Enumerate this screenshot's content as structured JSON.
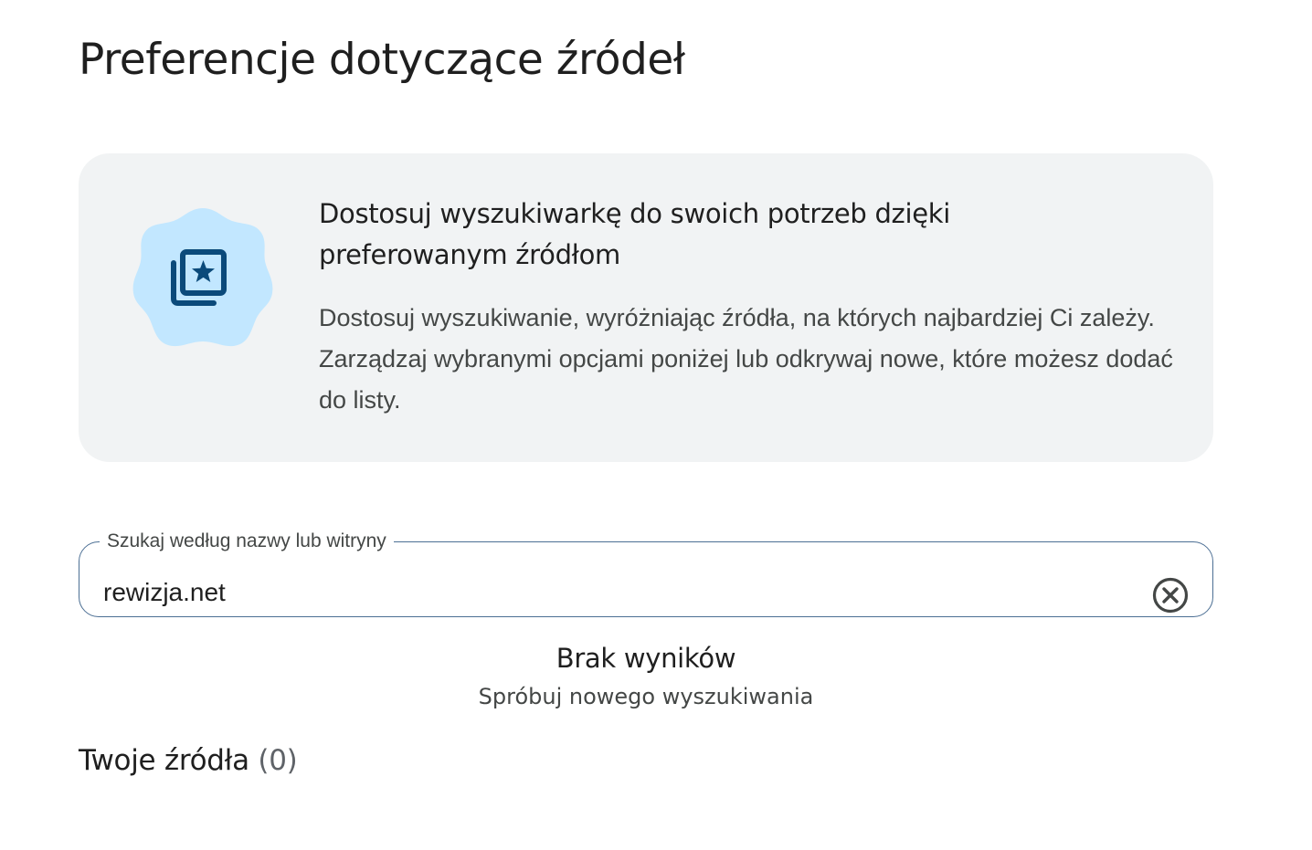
{
  "page": {
    "title": "Preferencje dotyczące źródeł"
  },
  "info_card": {
    "icon": "starred-collection-icon",
    "heading": "Dostosuj wyszukiwarkę do swoich potrzeb dzięki preferowanym źródłom",
    "body": "Dostosuj wyszukiwanie, wyróżniając źródła, na których najbardziej Ci zależy. Zarządzaj wybranymi opcjami poniżej lub odkrywaj nowe, które możesz dodać do listy.",
    "badge_color": "#c2e7ff",
    "icon_color": "#0b4a7a"
  },
  "search": {
    "label": "Szukaj według nazwy lub witryny",
    "value": "rewizja.net",
    "clear_icon": "close-circle-icon"
  },
  "results": {
    "title": "Brak wyników",
    "subtitle": "Spróbuj nowego wyszukiwania"
  },
  "sources": {
    "heading": "Twoje źródła",
    "count": "(0)"
  }
}
